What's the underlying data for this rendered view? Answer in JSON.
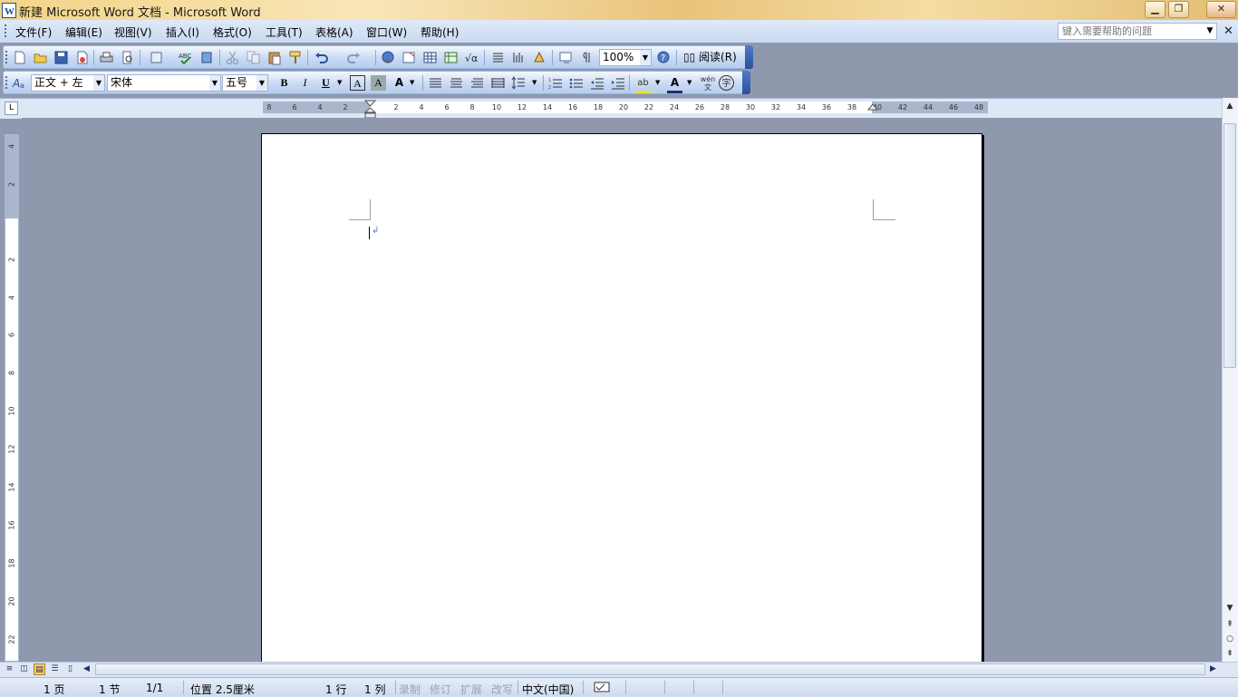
{
  "window": {
    "title": "新建 Microsoft Word 文档 - Microsoft Word",
    "minimize_label": "▁",
    "restore_label": "❐",
    "close_label": "✕"
  },
  "menu": {
    "items": [
      "文件(F)",
      "编辑(E)",
      "视图(V)",
      "插入(I)",
      "格式(O)",
      "工具(T)",
      "表格(A)",
      "窗口(W)",
      "帮助(H)"
    ],
    "help_placeholder": "键入需要帮助的问题",
    "doc_close_label": "✕"
  },
  "toolbar_standard": {
    "zoom": "100%",
    "reading_label": "阅读(R)",
    "icons": [
      "new-icon",
      "open-icon",
      "save-icon",
      "permission-icon",
      "print-icon",
      "print-preview-icon",
      "research-icon",
      "spelling-icon",
      "research-book-icon",
      "cut-icon",
      "copy-icon",
      "paste-icon",
      "format-painter-icon",
      "undo-icon",
      "redo-icon",
      "hyperlink-icon",
      "tables-borders-icon",
      "insert-table-icon",
      "insert-excel-icon",
      "equation-icon",
      "columns-icon",
      "drawing-icon",
      "document-map-icon",
      "show-hide-icon",
      "help-icon"
    ]
  },
  "toolbar_formatting": {
    "style": "正文 + 左",
    "font": "宋体",
    "size": "五号",
    "bold_label": "B",
    "italic_label": "I",
    "underline_label": "U",
    "char_border_label": "A",
    "char_shading_label": "A",
    "char_scale_label": "A",
    "highlight_label": "ab",
    "font_color_label": "A",
    "phonetic_label": "wén 文",
    "enclose_label": "字"
  },
  "ruler": {
    "h_labels_left": [
      "8",
      "6",
      "4",
      "2"
    ],
    "h_labels_right": [
      "2",
      "4",
      "6",
      "8",
      "10",
      "12",
      "14",
      "16",
      "18",
      "20",
      "22",
      "24",
      "26",
      "28",
      "30",
      "32",
      "34",
      "36",
      "38",
      "40",
      "42",
      "44",
      "46",
      "48"
    ],
    "v_labels_top": [
      "4",
      "2"
    ],
    "v_labels_main": [
      "2",
      "4",
      "6",
      "8",
      "10",
      "12",
      "14",
      "16",
      "18",
      "20",
      "22"
    ],
    "corner_label": "L"
  },
  "status": {
    "page": "1 页",
    "section": "1 节",
    "pages": "1/1",
    "position": "位置 2.5厘米",
    "line": "1 行",
    "column": "1 列",
    "rec": "录制",
    "trk": "修订",
    "ext": "扩展",
    "ovr": "改写",
    "language": "中文(中国)"
  }
}
